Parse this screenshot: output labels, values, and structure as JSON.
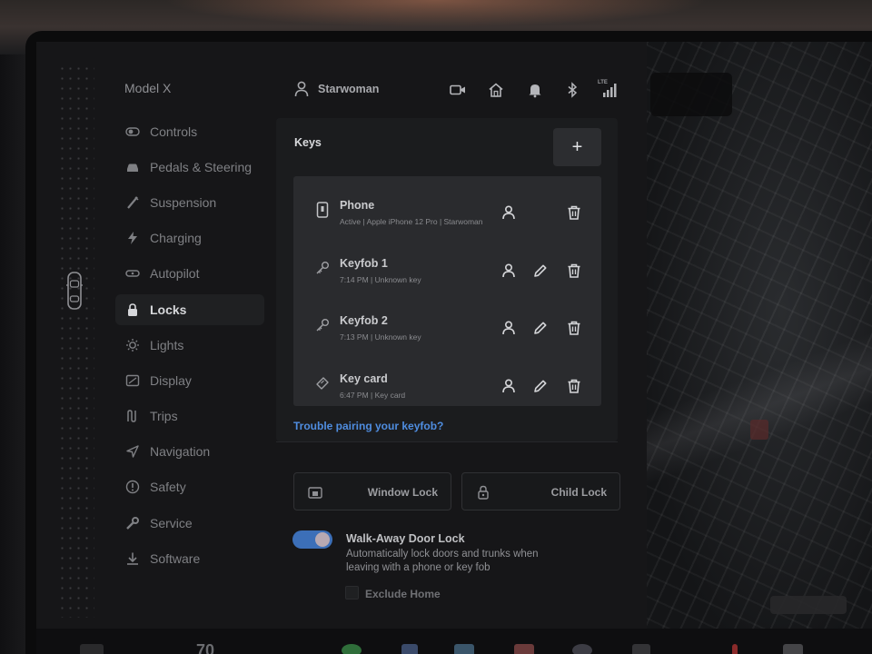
{
  "vehicle": {
    "model": "Model X"
  },
  "header": {
    "user_name": "Starwoman",
    "icons": [
      "dashcam-icon",
      "home-icon",
      "bell-icon",
      "bluetooth-icon",
      "lte-signal-icon"
    ],
    "network_label": "LTE"
  },
  "sidebar": {
    "items": [
      {
        "label": "Controls",
        "icon": "toggle-icon",
        "active": false
      },
      {
        "label": "Pedals & Steering",
        "icon": "car-icon",
        "active": false
      },
      {
        "label": "Suspension",
        "icon": "suspension-icon",
        "active": false
      },
      {
        "label": "Charging",
        "icon": "lightning-icon",
        "active": false
      },
      {
        "label": "Autopilot",
        "icon": "steering-wheel-icon",
        "active": false
      },
      {
        "label": "Locks",
        "icon": "lock-icon",
        "active": true
      },
      {
        "label": "Lights",
        "icon": "sun-icon",
        "active": false
      },
      {
        "label": "Display",
        "icon": "display-icon",
        "active": false
      },
      {
        "label": "Trips",
        "icon": "trips-icon",
        "active": false
      },
      {
        "label": "Navigation",
        "icon": "navigation-arrow-icon",
        "active": false
      },
      {
        "label": "Safety",
        "icon": "alert-circle-icon",
        "active": false
      },
      {
        "label": "Service",
        "icon": "wrench-icon",
        "active": false
      },
      {
        "label": "Software",
        "icon": "download-icon",
        "active": false
      }
    ]
  },
  "keys": {
    "title": "Keys",
    "add_label": "+",
    "items": [
      {
        "name": "Phone",
        "detail": "Active | Apple iPhone 12 Pro | Starwoman",
        "icon": "phone-key-icon",
        "editable": false
      },
      {
        "name": "Keyfob 1",
        "detail": "7:14 PM | Unknown key",
        "icon": "key-icon",
        "editable": true
      },
      {
        "name": "Keyfob 2",
        "detail": "7:13 PM | Unknown key",
        "icon": "key-icon",
        "editable": true
      },
      {
        "name": "Key card",
        "detail": "6:47 PM | Key card",
        "icon": "key-card-icon",
        "editable": true
      }
    ],
    "trouble_link": "Trouble pairing your keyfob?"
  },
  "locks": {
    "window_lock": "Window Lock",
    "child_lock": "Child Lock"
  },
  "walk_away": {
    "title": "Walk-Away Door Lock",
    "description": "Automatically lock doors and trunks when leaving with a phone or key fob",
    "enabled": true,
    "exclude_home_label": "Exclude Home",
    "exclude_home_checked": false
  },
  "dock": {
    "temperature": "70"
  },
  "colors": {
    "accent": "#3c6fb8",
    "link": "#4f8de0",
    "panel": "#1b1c1e",
    "active_nav": "#1f2022"
  }
}
